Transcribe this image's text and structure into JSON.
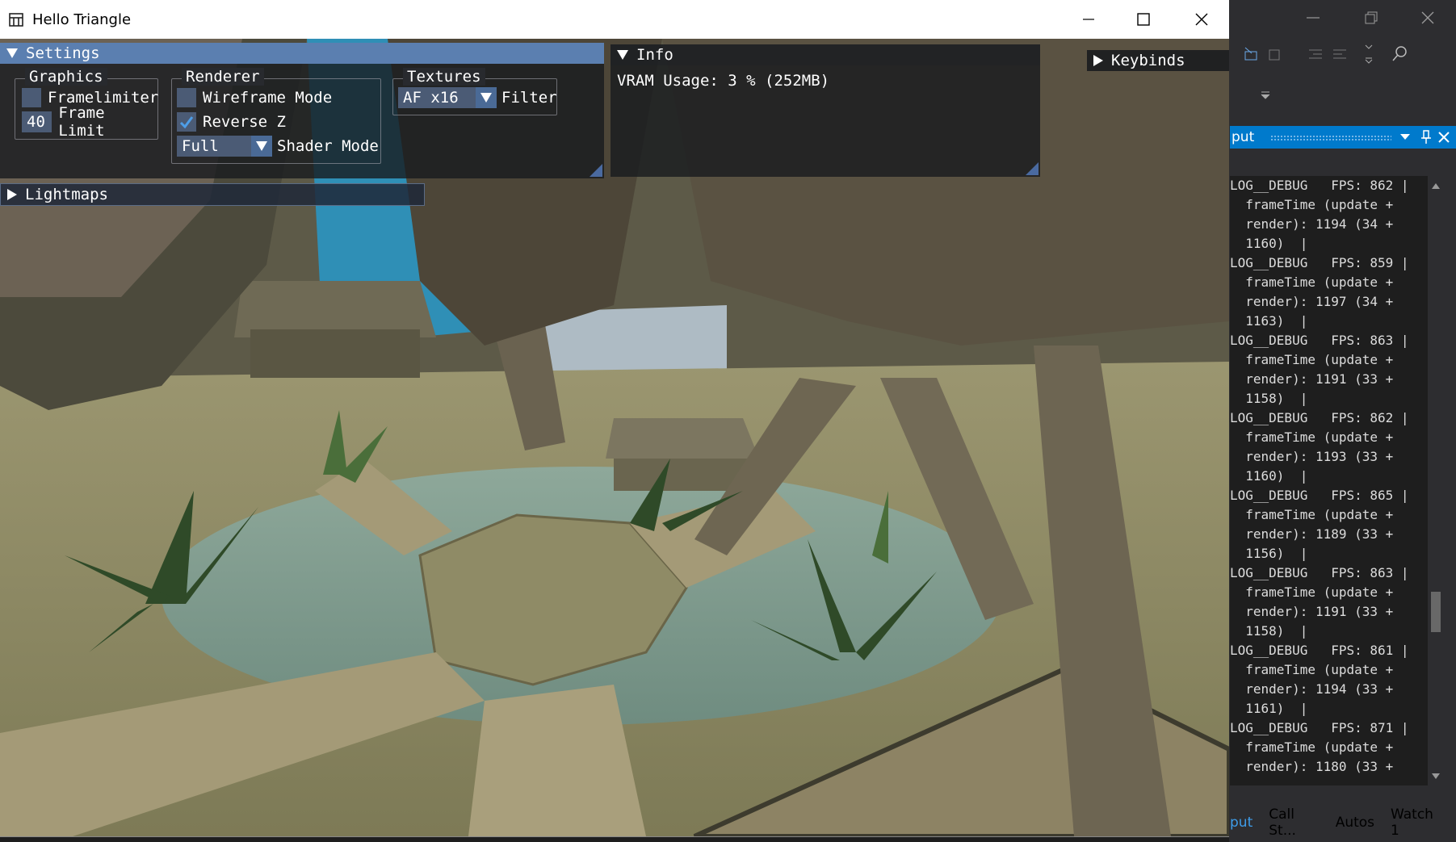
{
  "window": {
    "title": "Hello Triangle"
  },
  "settings": {
    "header": "Settings",
    "graphics": {
      "title": "Graphics",
      "framelimiter_label": "Framelimiter",
      "framelimiter_checked": false,
      "frame_limit_value": "40",
      "frame_limit_label": "Frame Limit"
    },
    "renderer": {
      "title": "Renderer",
      "wireframe_label": "Wireframe Mode",
      "wireframe_checked": false,
      "reverse_z_label": "Reverse Z",
      "reverse_z_checked": true,
      "shader_mode_value": "Full",
      "shader_mode_label": "Shader Mode"
    },
    "textures": {
      "title": "Textures",
      "filter_value": "AF x16",
      "filter_label": "Filter"
    }
  },
  "lightmaps": {
    "header": "Lightmaps"
  },
  "info": {
    "header": "Info",
    "vram": "VRAM Usage: 3 % (252MB)"
  },
  "keybinds": {
    "header": "Keybinds"
  },
  "output": {
    "tab_label": "put",
    "lines": [
      "LOG__DEBUG   FPS: 862 |",
      "  frameTime (update +",
      "  render): 1194 (34 +",
      "  1160)  |",
      "LOG__DEBUG   FPS: 859 |",
      "  frameTime (update +",
      "  render): 1197 (34 +",
      "  1163)  |",
      "LOG__DEBUG   FPS: 863 |",
      "  frameTime (update +",
      "  render): 1191 (33 +",
      "  1158)  |",
      "LOG__DEBUG   FPS: 862 |",
      "  frameTime (update +",
      "  render): 1193 (33 +",
      "  1160)  |",
      "LOG__DEBUG   FPS: 865 |",
      "  frameTime (update +",
      "  render): 1189 (33 +",
      "  1156)  |",
      "LOG__DEBUG   FPS: 863 |",
      "  frameTime (update +",
      "  render): 1191 (33 +",
      "  1158)  |",
      "LOG__DEBUG   FPS: 861 |",
      "  frameTime (update +",
      "  render): 1194 (33 +",
      "  1161)  |",
      "LOG__DEBUG   FPS: 871 |",
      "  frameTime (update +",
      "  render): 1180 (33 +"
    ],
    "bottom_tabs": [
      "put",
      "Call St...",
      "Autos",
      "Watch 1"
    ]
  },
  "colors": {
    "imgui_header": "#5b7fb0",
    "imgui_frame": "#4b5b75",
    "vs_accent": "#007acc",
    "vs_background": "#2d2d30"
  }
}
